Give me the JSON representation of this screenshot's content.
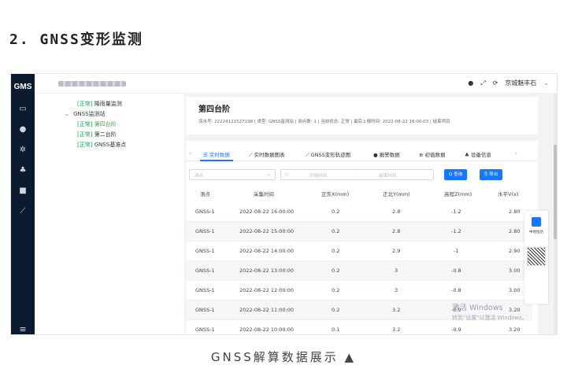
{
  "article": {
    "heading": "2. GNSS变形监测",
    "caption": "GNSS解算数据展示 ▲"
  },
  "app": {
    "logo": "GMS",
    "nav_menu_glyph": "≡",
    "top_actions": {
      "bell": "●",
      "expand": "⤢",
      "refresh": "⟳",
      "user": "京城魅丰石",
      "chevron": "⌄"
    }
  },
  "tree": {
    "items": [
      {
        "tag": "[正常]",
        "label": "降雨量监测"
      },
      {
        "caret": "⌄",
        "label": "GNSS监测站"
      },
      {
        "tag": "[正常]",
        "label": "第四台阶"
      },
      {
        "tag": "[正常]",
        "label": "第二台阶"
      },
      {
        "tag": "[正常]",
        "label": "GNSS基准点"
      }
    ]
  },
  "station": {
    "title": "第四台阶",
    "meta": "流水号: 22224121527198 | 类型: GNSS监测站 | 测点数: 1 | 当前状态: 正常 | 最后上报时间: 2022-08-22 16:00:03 | 结束项目"
  },
  "tabs": [
    {
      "icon": "☰",
      "label": "实时数据",
      "active": true
    },
    {
      "icon": "⟋",
      "label": "实时数据图表"
    },
    {
      "icon": "⟋",
      "label": "GNSS变形轨迹图"
    },
    {
      "icon": "●",
      "label": "报警数据"
    },
    {
      "icon": "⊕",
      "label": "初值数据"
    },
    {
      "icon": "♣",
      "label": "设备信息"
    }
  ],
  "filters": {
    "point_placeholder": "测点",
    "start_placeholder": "开始时间",
    "end_placeholder": "结束时间",
    "separator": "-",
    "query_label": "Q 查询",
    "export_label": "⎘ 导出"
  },
  "table": {
    "headers": [
      "测点",
      "采集时间",
      "正东X(mm)",
      "正北Y(mm)",
      "高程Z(mm)",
      "水平V(x)"
    ],
    "rows": [
      [
        "GNSS-1",
        "2022-08-22 16:00:00",
        "0.2",
        "2.8",
        "-1.2",
        "2.80"
      ],
      [
        "GNSS-1",
        "2022-08-22 15:00:00",
        "0.2",
        "2.8",
        "-1.2",
        "2.80"
      ],
      [
        "GNSS-1",
        "2022-08-22 14:00:00",
        "0.2",
        "2.9",
        "-1",
        "2.90"
      ],
      [
        "GNSS-1",
        "2022-08-22 13:00:00",
        "0.2",
        "3",
        "-0.8",
        "3.00"
      ],
      [
        "GNSS-1",
        "2022-08-22 12:00:00",
        "0.2",
        "3",
        "-0.8",
        "3.00"
      ],
      [
        "GNSS-1",
        "2022-08-22 11:00:00",
        "0.2",
        "3.2",
        "-0.9",
        "3.20"
      ],
      [
        "GNSS-1",
        "2022-08-22 10:00:00",
        "0.1",
        "3.2",
        "-0.9",
        "3.20"
      ]
    ]
  },
  "watermark": {
    "line1": "激活 Windows",
    "line2": "转到\"设置\"以激活 Windows。"
  },
  "float_panel": {
    "label": "中地恒达"
  },
  "colors": {
    "accent": "#1677ff",
    "ok": "#1aa34a",
    "sidebar": "#0b1a2e"
  }
}
